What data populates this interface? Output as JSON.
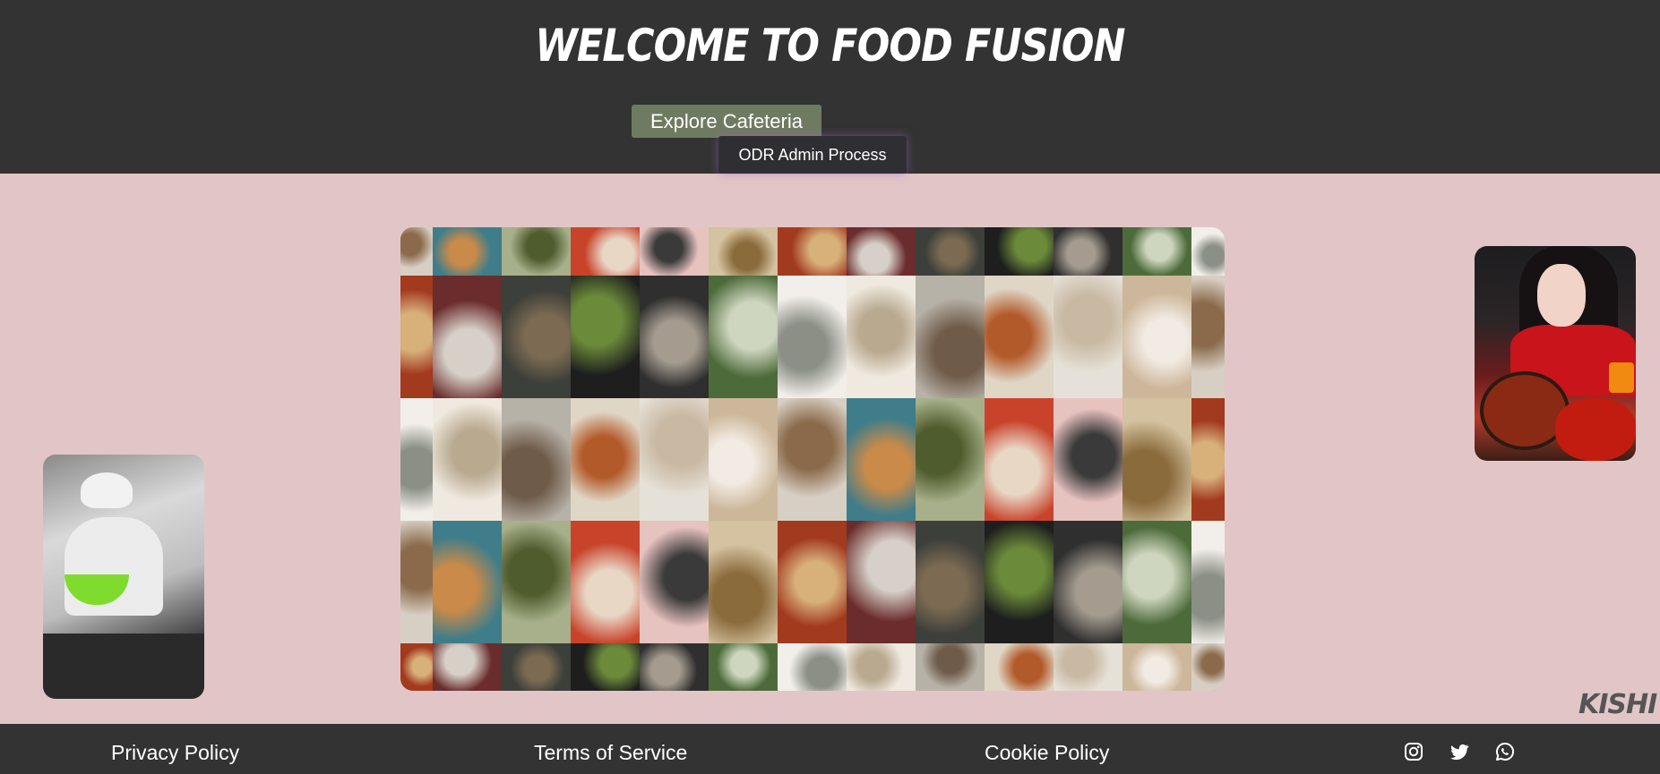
{
  "header": {
    "title": "Welcome to Food Fusion",
    "explore_button": "Explore Cafeteria",
    "dropdown_item": "ODR Admin Process"
  },
  "footer": {
    "links": [
      "Privacy Policy",
      "Terms of Service",
      "Cookie Policy"
    ],
    "social_icons": [
      "instagram-icon",
      "twitter-icon",
      "whatsapp-icon"
    ]
  },
  "watermark": "KISHI",
  "colors": {
    "header_bg": "#333333",
    "page_bg": "#e2c6c7",
    "button_bg": "#6f7b60",
    "dropdown_bg": "#2f2f33"
  }
}
